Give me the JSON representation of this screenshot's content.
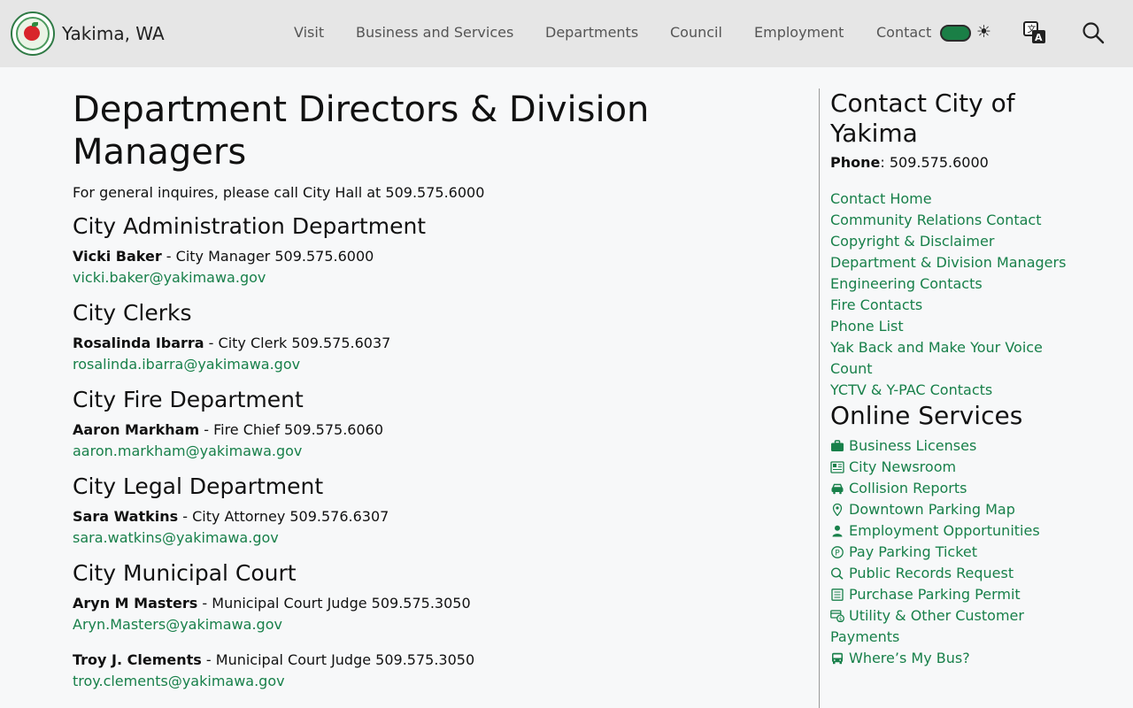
{
  "header": {
    "site_title": "Yakima, WA",
    "nav": [
      "Visit",
      "Business and Services",
      "Departments",
      "Council",
      "Employment",
      "Contact"
    ],
    "theme_icon": "sun-icon",
    "translate_icon": "translate-icon",
    "search_icon": "search-icon",
    "accent": "#18804a"
  },
  "main": {
    "title": "Department Directors & Division Managers",
    "intro": "For general inquires, please call City Hall at 509.575.6000",
    "departments": [
      {
        "name": "City Administration Department",
        "people": [
          {
            "name": "Vicki Baker",
            "detail": " - City Manager 509.575.6000",
            "email": "vicki.baker@yakimawa.gov"
          }
        ]
      },
      {
        "name": "City Clerks",
        "people": [
          {
            "name": "Rosalinda Ibarra",
            "detail": " - City Clerk 509.575.6037",
            "email": "rosalinda.ibarra@yakimawa.gov"
          }
        ]
      },
      {
        "name": "City Fire Department",
        "people": [
          {
            "name": "Aaron Markham",
            "detail": " - Fire Chief 509.575.6060",
            "email": "aaron.markham@yakimawa.gov"
          }
        ]
      },
      {
        "name": "City Legal Department",
        "people": [
          {
            "name": "Sara Watkins",
            "detail": " - City Attorney 509.576.6307",
            "email": "sara.watkins@yakimawa.gov"
          }
        ]
      },
      {
        "name": "City Municipal Court",
        "people": [
          {
            "name": "Aryn M Masters",
            "detail": " - Municipal Court Judge 509.575.3050",
            "email": "Aryn.Masters@yakimawa.gov"
          },
          {
            "name": "Troy J. Clements",
            "detail": " - Municipal Court Judge 509.575.3050",
            "email": "troy.clements@yakimawa.gov"
          }
        ]
      }
    ]
  },
  "sidebar": {
    "contact_title": "Contact City of Yakima",
    "phone_label": "Phone",
    "phone_value": ": 509.575.6000",
    "links": [
      "Contact Home",
      "Community Relations Contact",
      "Copyright & Disclaimer",
      "Department & Division Managers",
      "Engineering Contacts",
      "Fire Contacts",
      "Phone List",
      "Yak Back and Make Your Voice Count",
      "YCTV & Y-PAC Contacts"
    ],
    "online_title": "Online Services",
    "services": [
      {
        "label": "Business Licenses",
        "icon": "briefcase-icon"
      },
      {
        "label": "City Newsroom",
        "icon": "newspaper-icon"
      },
      {
        "label": "Collision Reports",
        "icon": "car-icon"
      },
      {
        "label": "Downtown Parking Map",
        "icon": "map-pin-icon"
      },
      {
        "label": "Employment Opportunities",
        "icon": "person-icon"
      },
      {
        "label": "Pay Parking Ticket",
        "icon": "parking-icon"
      },
      {
        "label": "Public Records Request",
        "icon": "search-icon"
      },
      {
        "label": "Purchase Parking Permit",
        "icon": "receipt-icon"
      },
      {
        "label": "Utility & Other Customer Payments",
        "icon": "payment-icon"
      },
      {
        "label": "Where’s My Bus?",
        "icon": "bus-icon"
      }
    ]
  }
}
